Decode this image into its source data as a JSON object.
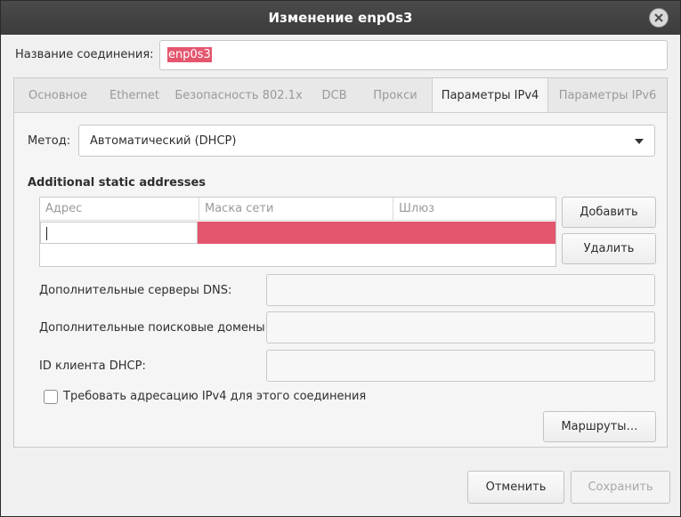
{
  "window": {
    "title": "Изменение enp0s3"
  },
  "connection": {
    "name_label": "Название соединения:",
    "name_value": "enp0s3"
  },
  "tabs": [
    {
      "label": "Основное"
    },
    {
      "label": "Ethernet"
    },
    {
      "label": "Безопасность 802.1x"
    },
    {
      "label": "DCB"
    },
    {
      "label": "Прокси"
    },
    {
      "label": "Параметры IPv4"
    },
    {
      "label": "Параметры IPv6"
    }
  ],
  "active_tab": "Параметры IPv4",
  "ipv4": {
    "method_label": "Метод:",
    "method_value": "Автоматический (DHCP)",
    "static_title": "Additional static addresses",
    "columns": [
      "Адрес",
      "Маска сети",
      "Шлюз"
    ],
    "add_button": "Добавить",
    "delete_button": "Удалить",
    "dns_label": "Дополнительные серверы DNS:",
    "dns_value": "",
    "search_label": "Дополнительные поисковые домены:",
    "search_value": "",
    "dhcp_label": "ID клиента DHCP:",
    "dhcp_value": "",
    "require_label": "Требовать адресацию IPv4 для этого соединения",
    "require_checked": false,
    "routes_button": "Маршруты…"
  },
  "footer": {
    "cancel": "Отменить",
    "save": "Сохранить"
  },
  "colors": {
    "selection": "#e4566e",
    "titlebar": "#3c3c3c"
  }
}
